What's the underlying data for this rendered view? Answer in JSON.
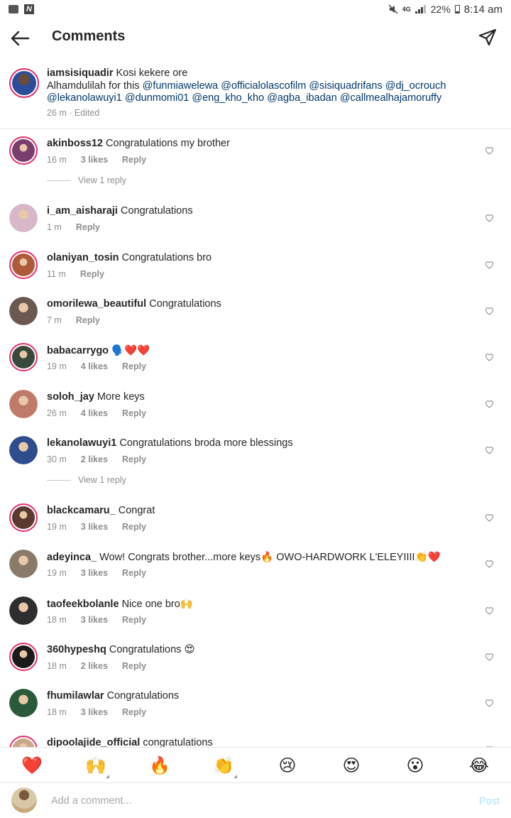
{
  "status_bar": {
    "battery": "22%",
    "time": "8:14 am",
    "network": "4G",
    "icons": [
      "gallery-icon",
      "n-app-icon",
      "mute-icon",
      "signal-icon",
      "battery-icon"
    ]
  },
  "header": {
    "title": "Comments",
    "back_icon": "arrow-left-icon",
    "share_icon": "send-icon"
  },
  "caption": {
    "username": "iamsisiquadir",
    "text_line1": "Kosi kekere ore",
    "text_prefix": "Alhamdulilah for this",
    "mentions": [
      "@funmiawelewa",
      "@officialolascofilm",
      "@sisiquadrifans",
      "@dj_ocrouch",
      "@lekanolawuyi1",
      "@dunmomi01",
      "@eng_kho_kho",
      "@agba_ibadan",
      "@callmealhajamoruffy"
    ],
    "time": "26 m",
    "edited": "Edited",
    "avatar_color": "#2a4e9b"
  },
  "comments": [
    {
      "username": "akinboss12",
      "text": "Congratulations my brother",
      "time": "16 m",
      "likes": "3 likes",
      "reply": "Reply",
      "view_reply": "View 1 reply",
      "avatar_color": "#7a3e6e"
    },
    {
      "username": "i_am_aisharaji",
      "text": "Congratulations",
      "time": "1 m",
      "likes": "",
      "reply": "Reply",
      "avatar_color": "#d8b8c8"
    },
    {
      "username": "olaniyan_tosin",
      "text": "Congratulations bro",
      "time": "11 m",
      "likes": "",
      "reply": "Reply",
      "avatar_color": "#b05a3a"
    },
    {
      "username": "omorilewa_beautiful",
      "text": "Congratulations",
      "time": "7 m",
      "likes": "",
      "reply": "Reply",
      "avatar_color": "#6b5850"
    },
    {
      "username": "babacarrygo",
      "text": "🗣️❤️❤️",
      "time": "19 m",
      "likes": "4 likes",
      "reply": "Reply",
      "avatar_color": "#3a4a3a"
    },
    {
      "username": "soloh_jay",
      "text": "More keys",
      "time": "26 m",
      "likes": "4 likes",
      "reply": "Reply",
      "avatar_color": "#c07a6a"
    },
    {
      "username": "lekanolawuyi1",
      "text": "Congratulations broda more blessings",
      "time": "30 m",
      "likes": "2 likes",
      "reply": "Reply",
      "view_reply": "View 1 reply",
      "avatar_color": "#2d4d8e"
    },
    {
      "username": "blackcamaru_",
      "text": "Congrat",
      "time": "19 m",
      "likes": "3 likes",
      "reply": "Reply",
      "avatar_color": "#5a3a2e"
    },
    {
      "username": "adeyinca_",
      "text": "Wow! Congrats brother...more keys🔥 OWO-HARDWORK L'ELEYIIII👏❤️",
      "time": "19 m",
      "likes": "3 likes",
      "reply": "Reply",
      "avatar_color": "#8a7a6a"
    },
    {
      "username": "taofeekbolanle",
      "text": "Nice one bro🙌",
      "time": "18 m",
      "likes": "3 likes",
      "reply": "Reply",
      "avatar_color": "#2e2e2e"
    },
    {
      "username": "360hypeshq",
      "text": "Congratulations 😍",
      "time": "18 m",
      "likes": "2 likes",
      "reply": "Reply",
      "avatar_color": "#1a1a1a"
    },
    {
      "username": "fhumilawlar",
      "text": "Congratulations",
      "time": "18 m",
      "likes": "3 likes",
      "reply": "Reply",
      "avatar_color": "#2a5a3a"
    },
    {
      "username": "dipoolajide_official",
      "text": "congratulations",
      "time": "",
      "likes": "",
      "reply": "",
      "avatar_color": "#c8a888"
    }
  ],
  "emoji_bar": [
    "❤️",
    "🙌",
    "🔥",
    "👏",
    "😢",
    "😍",
    "😮",
    "😂"
  ],
  "add_comment": {
    "placeholder": "Add a comment...",
    "post_label": "Post",
    "avatar_color": "#c9a97c"
  },
  "colors": {
    "story_ring": "#e1306c",
    "mention": "#00376b",
    "meta_gray": "#8e8e8e",
    "post_disabled": "#b2dffc"
  }
}
